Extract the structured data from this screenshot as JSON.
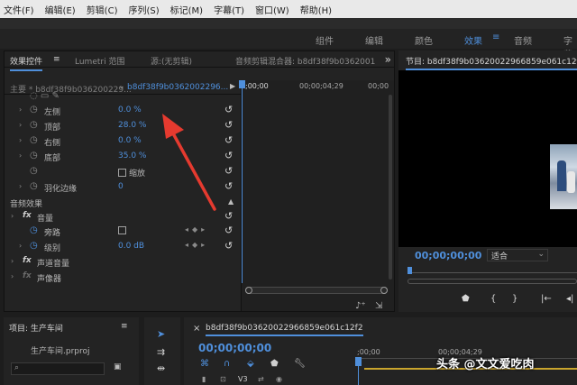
{
  "menu": {
    "items": [
      "文件(F)",
      "编辑(E)",
      "剪辑(C)",
      "序列(S)",
      "标记(M)",
      "字幕(T)",
      "窗口(W)",
      "帮助(H)"
    ]
  },
  "workspaces": {
    "items": [
      "组件",
      "编辑",
      "颜色",
      "效果",
      "音频",
      "字幕"
    ],
    "active": "效果"
  },
  "effect_controls": {
    "tabs": [
      "效果控件",
      "Lumetri 范围",
      "源:(无剪辑)",
      "音频剪辑混合器: b8df38f9b0362001"
    ],
    "source_bar": {
      "master": "主要 * b8df38f9b036200229...",
      "clip": "b8df38f9b0362002296..."
    },
    "crop_properties": [
      {
        "name": "左侧",
        "value": "0.0 %"
      },
      {
        "name": "顶部",
        "value": "28.0 %"
      },
      {
        "name": "右侧",
        "value": "0.0 %"
      },
      {
        "name": "底部",
        "value": "35.0 %"
      }
    ],
    "zoom_label": "缩放",
    "feather": {
      "name": "羽化边缘",
      "value": "0"
    },
    "audio_effects_label": "音频效果",
    "volume": {
      "name": "音量",
      "bypass_label": "旁路",
      "level_name": "级别",
      "level_value": "0.0 dB"
    },
    "channel_volume_label": "声道音量",
    "panner_label": "声像器",
    "timeline": {
      "tc_start": ";00;00",
      "tc_mid": "00;00;04;29",
      "tc_end": "00;00"
    }
  },
  "program": {
    "title": "节目: b8df38f9b03620022966859e061c12f2",
    "timecode": "00;00;00;00",
    "fit": "适合"
  },
  "project": {
    "title": "项目: 生产车间",
    "file": "生产车间.prproj"
  },
  "timeline_panel": {
    "title": "b8df38f9b03620022966859e061c12f2",
    "timecode": "00;00;00;00",
    "ruler_start": ";00;00",
    "ruler_mid": "00;00;04;29",
    "track_label": "V3"
  },
  "watermark": "头条 @文文爱吃肉",
  "colors": {
    "accent": "#4f8fdb",
    "arrow": "#e53a2f",
    "work_area": "#caa52d"
  }
}
